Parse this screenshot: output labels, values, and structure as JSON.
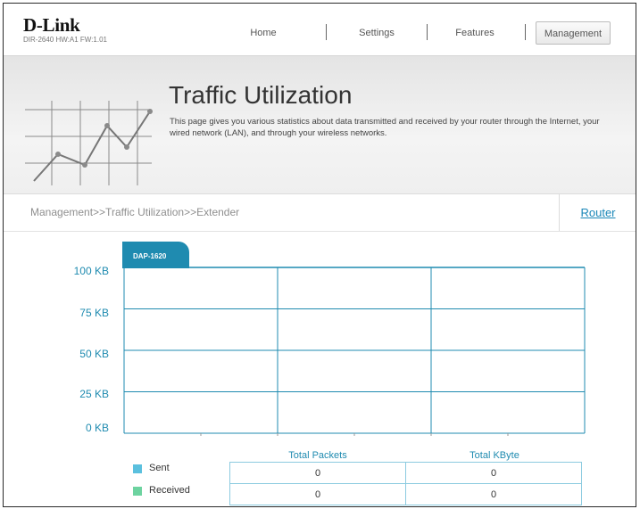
{
  "header": {
    "logo": "D-Link",
    "logo_sub": "DIR-2640 HW:A1 FW:1.01",
    "nav": {
      "home": "Home",
      "settings": "Settings",
      "features": "Features",
      "management": "Management"
    }
  },
  "banner": {
    "title": "Traffic Utilization",
    "description": "This page gives you various statistics about data transmitted and received by your router through the Internet, your wired network (LAN), and through your wireless networks."
  },
  "breadcrumb": {
    "path": "Management>>Traffic Utilization>>Extender",
    "router_link": "Router"
  },
  "chart_data": {
    "type": "line",
    "tab": "DAP-1620",
    "y_ticks": [
      "100 KB",
      "75 KB",
      "50 KB",
      "25 KB",
      "0 KB"
    ],
    "ylim": [
      0,
      100
    ],
    "series": [],
    "grid": true,
    "accent_color": "#1f8bb0"
  },
  "stats": {
    "headers": {
      "packets": "Total Packets",
      "kbyte": "Total KByte"
    },
    "rows": [
      {
        "label": "Sent",
        "color": "#5bc0de",
        "packets": "0",
        "kbyte": "0"
      },
      {
        "label": "Received",
        "color": "#6dd3a0",
        "packets": "0",
        "kbyte": "0"
      }
    ]
  }
}
